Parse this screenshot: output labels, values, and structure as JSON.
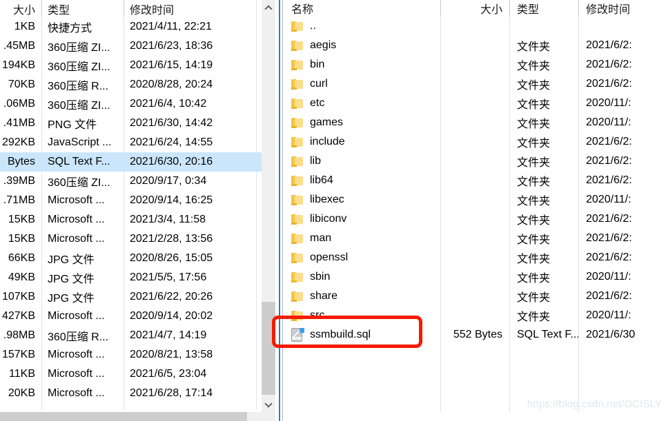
{
  "watermark": "https://blog.csdn.net/OCISLY",
  "left_pane": {
    "headers": {
      "size": "大小",
      "type": "类型",
      "date": "修改时间"
    },
    "rows": [
      {
        "size": "1KB",
        "type": "快捷方式",
        "date": "2021/4/11, 22:21",
        "selected": false
      },
      {
        "size": ".45MB",
        "type": "360压缩 ZI...",
        "date": "2021/6/23, 18:36",
        "selected": false
      },
      {
        "size": "194KB",
        "type": "360压缩 ZI...",
        "date": "2021/6/15, 14:19",
        "selected": false
      },
      {
        "size": "70KB",
        "type": "360压缩 R...",
        "date": "2020/8/28, 20:24",
        "selected": false
      },
      {
        "size": ".06MB",
        "type": "360压缩 ZI...",
        "date": "2021/6/4, 10:42",
        "selected": false
      },
      {
        "size": ".41MB",
        "type": "PNG 文件",
        "date": "2021/6/30, 14:42",
        "selected": false
      },
      {
        "size": "292KB",
        "type": "JavaScript ...",
        "date": "2021/6/24, 14:55",
        "selected": false
      },
      {
        "size": "Bytes",
        "type": "SQL Text F...",
        "date": "2021/6/30, 20:16",
        "selected": true
      },
      {
        "size": ".39MB",
        "type": "360压缩 ZI...",
        "date": "2020/9/17, 0:34",
        "selected": false
      },
      {
        "size": ".71MB",
        "type": "Microsoft ...",
        "date": "2020/9/14, 16:25",
        "selected": false
      },
      {
        "size": "15KB",
        "type": "Microsoft ...",
        "date": "2021/3/4, 11:58",
        "selected": false
      },
      {
        "size": "15KB",
        "type": "Microsoft ...",
        "date": "2021/2/28, 13:56",
        "selected": false
      },
      {
        "size": "66KB",
        "type": "JPG 文件",
        "date": "2020/8/26, 15:05",
        "selected": false
      },
      {
        "size": "49KB",
        "type": "JPG 文件",
        "date": "2021/5/5, 17:56",
        "selected": false
      },
      {
        "size": "107KB",
        "type": "JPG 文件",
        "date": "2021/6/22, 20:26",
        "selected": false
      },
      {
        "size": "427KB",
        "type": "Microsoft ...",
        "date": "2020/9/14, 20:02",
        "selected": false
      },
      {
        "size": ".98MB",
        "type": "360压缩 R...",
        "date": "2021/4/7, 14:19",
        "selected": false
      },
      {
        "size": "157KB",
        "type": "Microsoft ...",
        "date": "2020/8/21, 13:58",
        "selected": false
      },
      {
        "size": "11KB",
        "type": "Microsoft ...",
        "date": "2021/6/5, 23:04",
        "selected": false
      },
      {
        "size": "20KB",
        "type": "Microsoft ...",
        "date": "2021/6/28, 17:14",
        "selected": false
      }
    ],
    "scrollbar": {
      "up_arrow": "scroll-up-icon",
      "down_arrow": "scroll-down-icon"
    }
  },
  "right_pane": {
    "headers": {
      "name": "名称",
      "size": "大小",
      "type": "类型",
      "date": "修改时间"
    },
    "rows": [
      {
        "icon": "folder-icon",
        "name": "..",
        "size": "",
        "type": "",
        "date": ""
      },
      {
        "icon": "folder-icon",
        "name": "aegis",
        "size": "",
        "type": "文件夹",
        "date": "2021/6/2:"
      },
      {
        "icon": "folder-icon",
        "name": "bin",
        "size": "",
        "type": "文件夹",
        "date": "2021/6/2:"
      },
      {
        "icon": "folder-icon",
        "name": "curl",
        "size": "",
        "type": "文件夹",
        "date": "2021/6/2:"
      },
      {
        "icon": "folder-icon",
        "name": "etc",
        "size": "",
        "type": "文件夹",
        "date": "2020/11/:"
      },
      {
        "icon": "folder-icon",
        "name": "games",
        "size": "",
        "type": "文件夹",
        "date": "2020/11/:"
      },
      {
        "icon": "folder-icon",
        "name": "include",
        "size": "",
        "type": "文件夹",
        "date": "2021/6/2:"
      },
      {
        "icon": "folder-icon",
        "name": "lib",
        "size": "",
        "type": "文件夹",
        "date": "2021/6/2:"
      },
      {
        "icon": "folder-icon",
        "name": "lib64",
        "size": "",
        "type": "文件夹",
        "date": "2021/6/2:"
      },
      {
        "icon": "folder-icon",
        "name": "libexec",
        "size": "",
        "type": "文件夹",
        "date": "2020/11/:"
      },
      {
        "icon": "folder-icon",
        "name": "libiconv",
        "size": "",
        "type": "文件夹",
        "date": "2021/6/2:"
      },
      {
        "icon": "folder-icon",
        "name": "man",
        "size": "",
        "type": "文件夹",
        "date": "2021/6/2:"
      },
      {
        "icon": "folder-icon",
        "name": "openssl",
        "size": "",
        "type": "文件夹",
        "date": "2021/6/2:"
      },
      {
        "icon": "folder-icon",
        "name": "sbin",
        "size": "",
        "type": "文件夹",
        "date": "2020/11/:"
      },
      {
        "icon": "folder-icon",
        "name": "share",
        "size": "",
        "type": "文件夹",
        "date": "2021/6/2:"
      },
      {
        "icon": "folder-icon",
        "name": "src",
        "size": "",
        "type": "文件夹",
        "date": "2020/11/:"
      },
      {
        "icon": "sql-file-icon",
        "name": "ssmbuild.sql",
        "size": "552 Bytes",
        "type": "SQL Text F...",
        "date": "2021/6/30"
      }
    ]
  },
  "annotation": {
    "highlight_color": "#f51a00",
    "target": "ssmbuild.sql"
  }
}
